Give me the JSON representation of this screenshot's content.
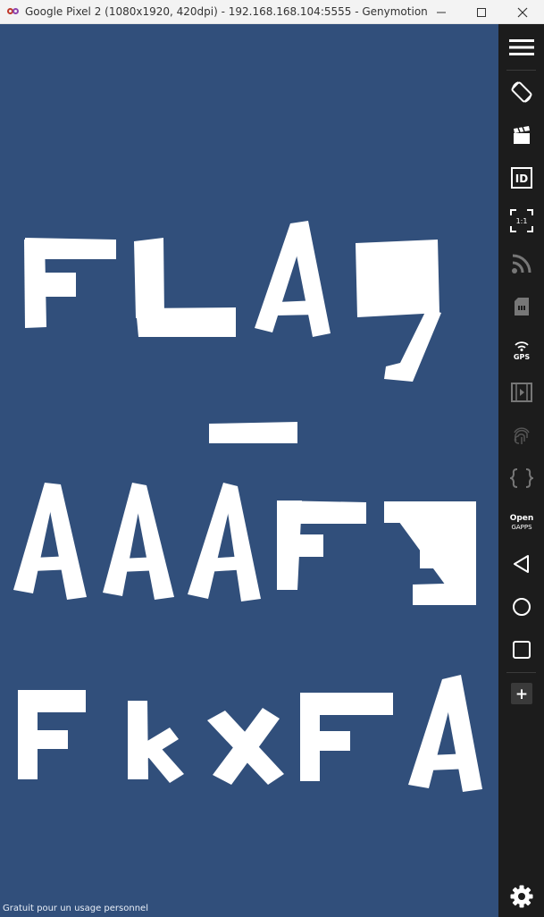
{
  "window": {
    "title": "Google Pixel 2 (1080x1920, 420dpi) - 192.168.168.104:5555 - Genymotion",
    "minimize_label": "—",
    "maximize_label": "☐",
    "close_label": "✕"
  },
  "screen": {
    "background": "#314f7b",
    "glyph_color": "#ffffff",
    "flag_text_lines": [
      "FLAg",
      "—",
      "AAAFE",
      "FkxFA"
    ],
    "watermark": "Gratuit pour un usage personnel"
  },
  "toolbar": {
    "items": [
      {
        "name": "menu-icon",
        "label": ""
      },
      {
        "name": "rotate-icon",
        "label": ""
      },
      {
        "name": "capture-icon",
        "label": ""
      },
      {
        "name": "id-icon",
        "label": "ID"
      },
      {
        "name": "pixel-perfect-icon",
        "label": "1:1"
      },
      {
        "name": "network-icon",
        "label": ""
      },
      {
        "name": "sim-icon",
        "label": ""
      },
      {
        "name": "gps-icon",
        "label": "GPS"
      },
      {
        "name": "media-icon",
        "label": ""
      },
      {
        "name": "fingerprint-icon",
        "label": ""
      },
      {
        "name": "code-icon",
        "label": ""
      },
      {
        "name": "opengapps-icon",
        "label_top": "Open",
        "label_bottom": "GAPPS"
      },
      {
        "name": "back-icon",
        "label": ""
      },
      {
        "name": "home-icon",
        "label": ""
      },
      {
        "name": "recents-icon",
        "label": ""
      },
      {
        "name": "add-icon",
        "label": "+"
      },
      {
        "name": "settings-icon",
        "label": ""
      }
    ]
  }
}
